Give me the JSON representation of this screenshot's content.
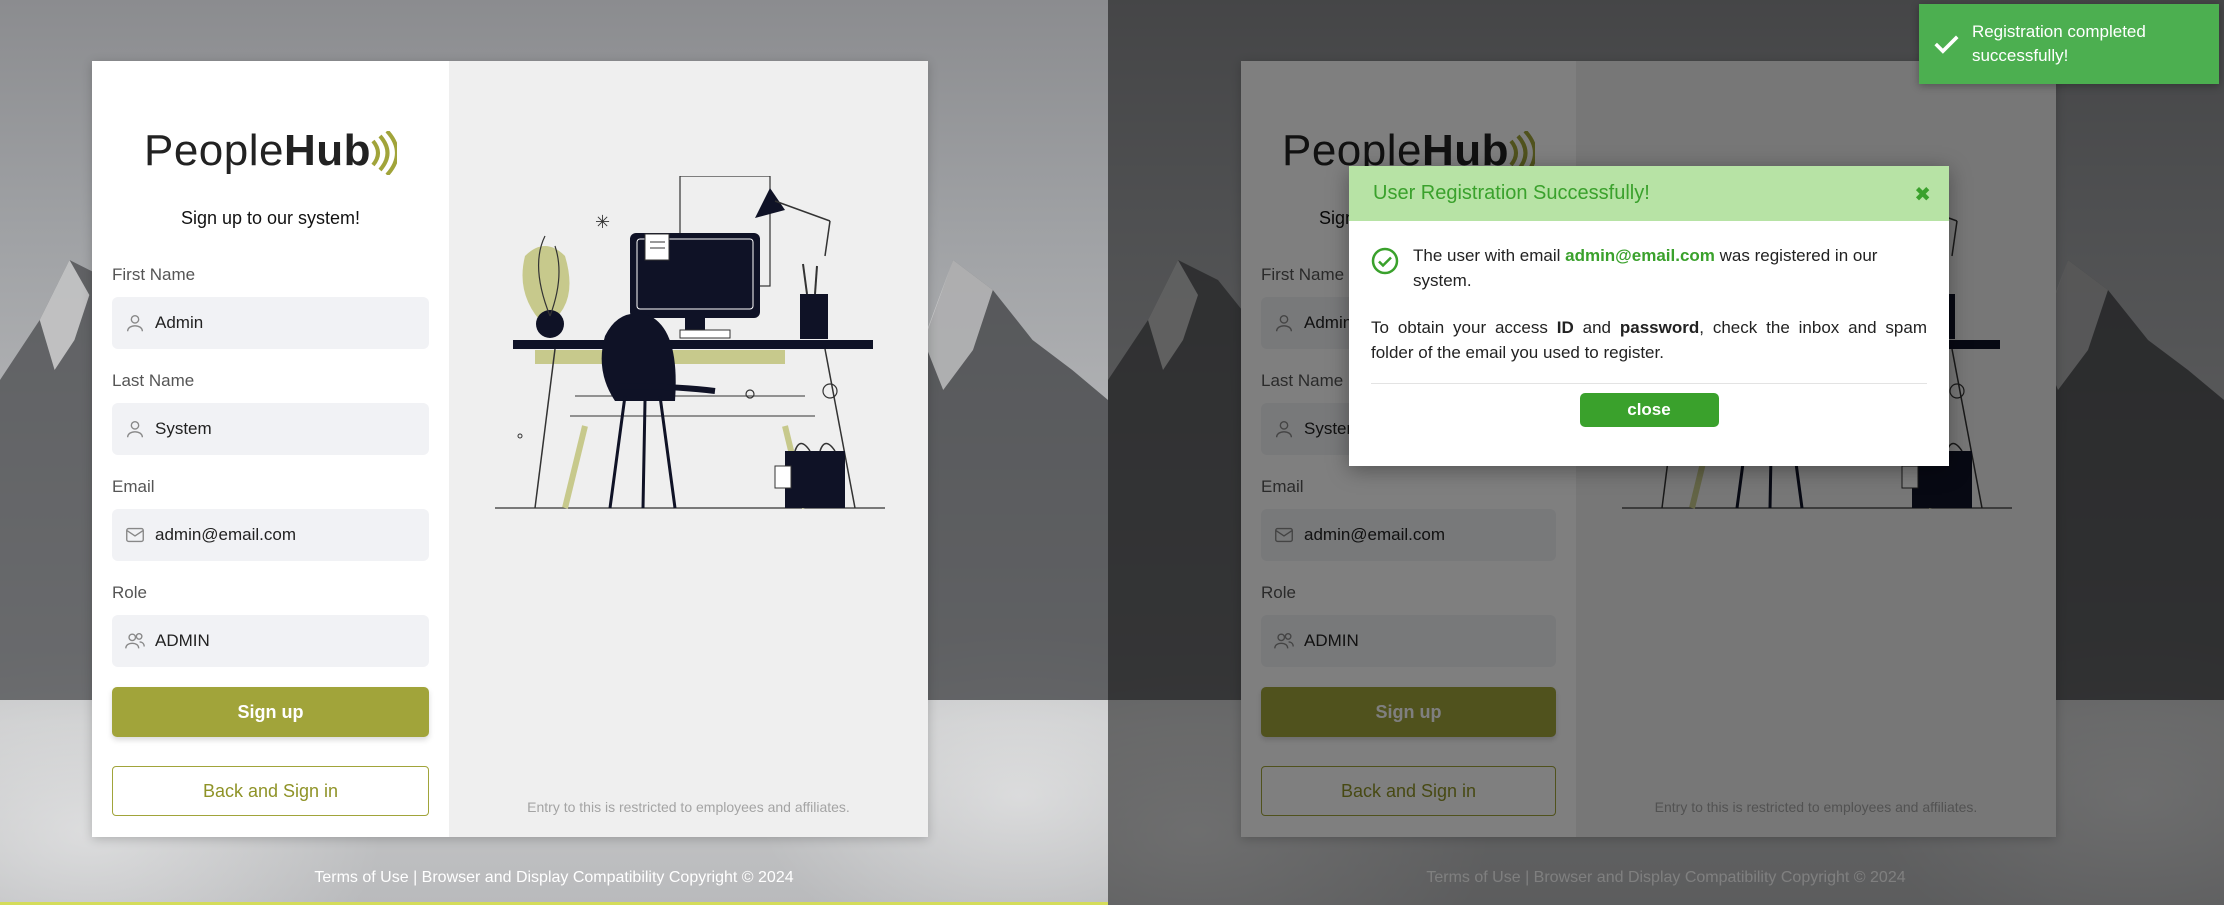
{
  "brand": {
    "logo_text_light": "People",
    "logo_text_bold": "Hub"
  },
  "form": {
    "subtitle": "Sign up to our system!",
    "first_name": {
      "label": "First Name",
      "value": "Admin",
      "icon": "user-icon"
    },
    "last_name": {
      "label": "Last Name",
      "value": "System",
      "icon": "user-icon"
    },
    "email": {
      "label": "Email",
      "value": "admin@email.com",
      "icon": "mail-icon"
    },
    "role": {
      "label": "Role",
      "value": "ADMIN",
      "icon": "users-icon"
    },
    "signup_label": "Sign up",
    "back_label": "Back and Sign in"
  },
  "restricted_note": "Entry to this is restricted to employees and affiliates.",
  "footer": {
    "terms": "Terms of Use",
    "separator": "|",
    "compat": "Browser and Display Compatibility Copyright © 2024"
  },
  "modal": {
    "title": "User Registration Successfully!",
    "close_icon": "close-icon",
    "line1_pre": "The user with email ",
    "line1_email": "admin@email.com",
    "line1_post": " was registered in our system.",
    "line2_pre": "To obtain your access ",
    "line2_id": "ID",
    "line2_and": " and ",
    "line2_password": "password",
    "line2_post": ", check the inbox and spam folder of the email you used to register.",
    "close_label": "close"
  },
  "toast": {
    "message": "Registration completed successfully!"
  },
  "colors": {
    "olive": "#a1a43a",
    "success_green": "#3aa12c",
    "toast_green": "#4caf50",
    "modal_header": "#b7e3a5"
  }
}
